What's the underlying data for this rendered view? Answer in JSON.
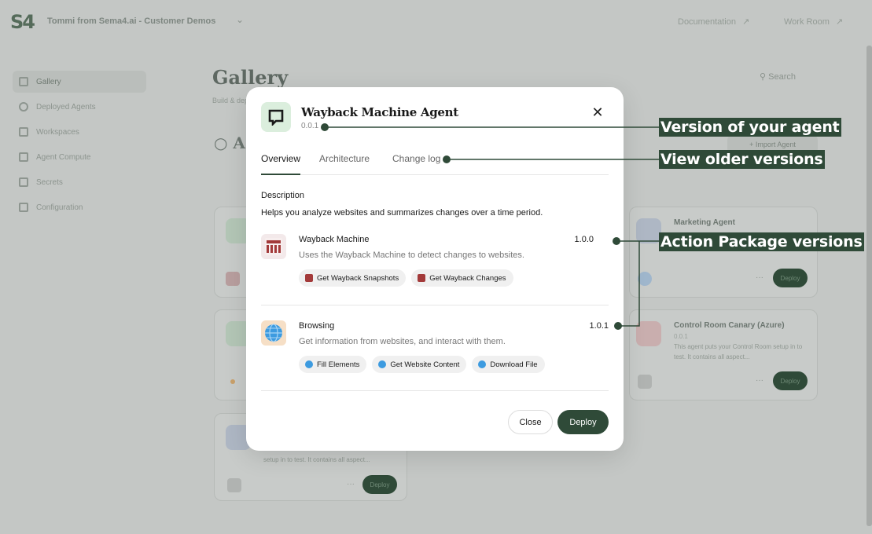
{
  "header": {
    "logo": "S4",
    "org": "Tommi from Sema4.ai - Customer Demos",
    "links": [
      "Documentation",
      "Work Room"
    ]
  },
  "sidebar": {
    "items": [
      {
        "label": "Gallery",
        "icon": "gallery-icon",
        "active": true
      },
      {
        "label": "Deployed Agents",
        "icon": "agents-icon",
        "active": false
      },
      {
        "label": "Workspaces",
        "icon": "workspaces-icon",
        "active": false
      },
      {
        "label": "Agent Compute",
        "icon": "compute-icon",
        "active": false
      },
      {
        "label": "Secrets",
        "icon": "secrets-icon",
        "active": false
      },
      {
        "label": "Configuration",
        "icon": "configuration-icon",
        "active": false
      }
    ]
  },
  "gallery": {
    "title": "Gallery",
    "subtitle": "Build & deploy",
    "search": "Search",
    "section_title": "A",
    "import_button": "Import Agent",
    "cards": [
      {
        "title": "Marketing Agent",
        "deploy": "Deploy"
      },
      {
        "title": "Control Room Canary (Azure)",
        "version": "0.0.1",
        "desc": "This agent puts your Control Room setup in to test. It contains all aspect...",
        "deploy": "Deploy"
      },
      {
        "desc": "setup in to test. It contains all aspect...",
        "deploy": "Deploy"
      }
    ]
  },
  "modal": {
    "title": "Wayback Machine Agent",
    "version": "0.0.1",
    "tabs": [
      "Overview",
      "Architecture",
      "Change log"
    ],
    "active_tab": "Overview",
    "description_heading": "Description",
    "description": "Helps you analyze websites and summarizes changes over a time period.",
    "packages": [
      {
        "name": "Wayback Machine",
        "desc": "Uses the Wayback Machine to detect changes to websites.",
        "version": "1.0.0",
        "icon": "wayback-machine-icon",
        "actions": [
          "Get Wayback Snapshots",
          "Get Wayback Changes"
        ]
      },
      {
        "name": "Browsing",
        "desc": "Get information from websites, and interact with them.",
        "version": "1.0.1",
        "icon": "browsing-globe-icon",
        "actions": [
          "Fill Elements",
          "Get Website Content",
          "Download File"
        ]
      }
    ],
    "close_button": "Close",
    "deploy_button": "Deploy"
  },
  "callouts": {
    "version": "Version of your agent",
    "older": "View older versions",
    "packages": "Action Package versions"
  },
  "colors": {
    "accent": "#2f4a38",
    "callout_bg": "#2f4a38",
    "overlay_bg": "#c4c7c5",
    "modal_bg": "#ffffff"
  }
}
